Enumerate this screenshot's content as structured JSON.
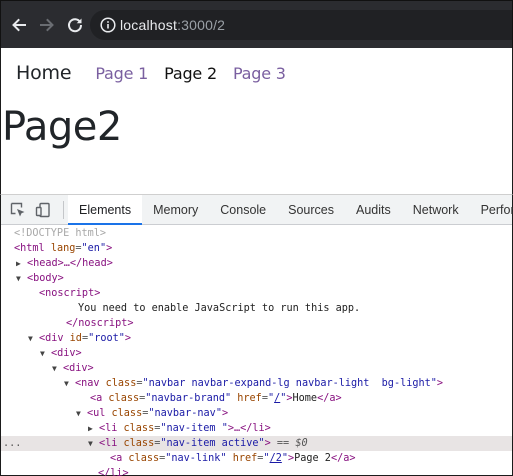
{
  "browser": {
    "url_host": "localhost",
    "url_rest": ":3000/2"
  },
  "page": {
    "navbar": {
      "brand": "Home",
      "links": [
        "Page 1",
        "Page 2",
        "Page 3"
      ],
      "active_link": "Page 2"
    },
    "heading": "Page2"
  },
  "devtools": {
    "tabs": [
      "Elements",
      "Memory",
      "Console",
      "Sources",
      "Audits",
      "Network",
      "Performa"
    ],
    "active_tab": "Elements",
    "dom": {
      "doctype": "<!DOCTYPE html>",
      "html_tag": "html",
      "lang_attr": "lang",
      "lang_val": "en",
      "head_collapsed": "<head>…</head>",
      "body_tag": "<body>",
      "noscript_open": "<noscript>",
      "noscript_text": "You need to enable JavaScript to run this app.",
      "noscript_close": "</noscript>",
      "div_tag": "div",
      "id_attr": "id",
      "root_val": "root",
      "div_open": "<div>",
      "nav_tag": "nav",
      "class_attr": "class",
      "nav_class_val": "navbar navbar-expand-lg navbar-light  bg-light",
      "a_tag": "a",
      "brand_class_val": "navbar-brand",
      "href_attr": "href",
      "brand_href": "/",
      "brand_text": "Home",
      "a_close": "</a>",
      "ul_tag": "ul",
      "ul_class_val": "navbar-nav",
      "li_tag": "li",
      "li_class_val": "nav-item ",
      "li_collapsed": "…</li>",
      "li_active_class_val": "nav-item active",
      "selected_marker": "== $0",
      "link_class_val": "nav-link",
      "link_href": "/2",
      "link_text": "Page 2",
      "li_close": "</li>",
      "row_dots": "..."
    }
  }
}
